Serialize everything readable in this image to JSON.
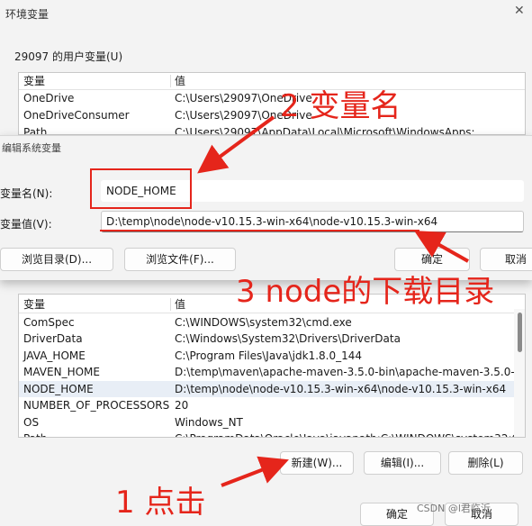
{
  "window": {
    "title": "环境变量",
    "close_glyph": "✕"
  },
  "user_vars": {
    "group_label": "29097 的用户变量(U)",
    "headers": {
      "name": "变量",
      "value": "值"
    },
    "rows": [
      {
        "name": "OneDrive",
        "value": "C:\\Users\\29097\\OneDrive"
      },
      {
        "name": "OneDriveConsumer",
        "value": "C:\\Users\\29097\\OneDrive"
      },
      {
        "name": "Path",
        "value": "C:\\Users\\29097\\AppData\\Local\\Microsoft\\WindowsApps;"
      }
    ]
  },
  "edit_dialog": {
    "title": "编辑系统变量",
    "name_label": "变量名(N):",
    "name_value": "NODE_HOME",
    "value_label": "变量值(V):",
    "value_value": "D:\\temp\\node\\node-v10.15.3-win-x64\\node-v10.15.3-win-x64",
    "browse_dir_label": "浏览目录(D)...",
    "browse_file_label": "浏览文件(F)...",
    "ok_label": "确定",
    "cancel_label": "取消"
  },
  "system_vars": {
    "headers": {
      "name": "变量",
      "value": "值"
    },
    "rows": [
      {
        "name": "ComSpec",
        "value": "C:\\WINDOWS\\system32\\cmd.exe"
      },
      {
        "name": "DriverData",
        "value": "C:\\Windows\\System32\\Drivers\\DriverData"
      },
      {
        "name": "JAVA_HOME",
        "value": "C:\\Program Files\\Java\\jdk1.8.0_144"
      },
      {
        "name": "MAVEN_HOME",
        "value": "D:\\temp\\maven\\apache-maven-3.5.0-bin\\apache-maven-3.5.0-..."
      },
      {
        "name": "NODE_HOME",
        "value": "D:\\temp\\node\\node-v10.15.3-win-x64\\node-v10.15.3-win-x64"
      },
      {
        "name": "NUMBER_OF_PROCESSORS",
        "value": "20"
      },
      {
        "name": "OS",
        "value": "Windows_NT"
      },
      {
        "name": "Path",
        "value": "C:\\ProgramData\\Oracle\\Java\\javapath;C:\\WINDOWS\\system32;C..."
      }
    ],
    "new_label": "新建(W)...",
    "edit_label": "编辑(I)...",
    "delete_label": "删除(L)"
  },
  "footer": {
    "ok_label": "确定",
    "cancel_label": "取消"
  },
  "annotations": {
    "step1": "1 点击",
    "step2": "2 变量名",
    "step3": "3 node的下载目录",
    "color": "#e5251b"
  },
  "watermark": "CSDN @l君临沂",
  "colors": {
    "selection": "#e8eef6",
    "annotation": "#e5251b"
  }
}
